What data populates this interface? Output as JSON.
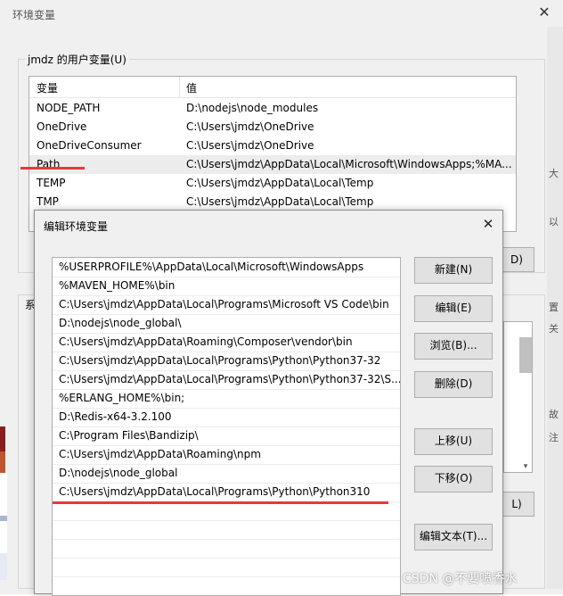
{
  "background_window": {
    "title": "环境变量",
    "close_glyph": "✕",
    "user_group_label": "jmdz 的用户变量(U)",
    "columns": {
      "name": "变量",
      "value": "值"
    },
    "user_vars": [
      {
        "name": "NODE_PATH",
        "value": "D:\\nodejs\\node_modules"
      },
      {
        "name": "OneDrive",
        "value": "C:\\Users\\jmdz\\OneDrive"
      },
      {
        "name": "OneDriveConsumer",
        "value": "C:\\Users\\jmdz\\OneDrive"
      },
      {
        "name": "Path",
        "value": "C:\\Users\\jmdz\\AppData\\Local\\Microsoft\\WindowsApps;%MA..."
      },
      {
        "name": "TEMP",
        "value": "C:\\Users\\jmdz\\AppData\\Local\\Temp"
      },
      {
        "name": "TMP",
        "value": "C:\\Users\\jmdz\\AppData\\Local\\Temp"
      }
    ],
    "selected_user_var": "Path",
    "sys_label_fragment": "系",
    "btn_fragment_d": "D)",
    "btn_fragment_l": "L)",
    "scroll_arrow": "▾"
  },
  "side_strip": [
    "大",
    "以",
    "置",
    "关",
    "故",
    "注"
  ],
  "edit_dialog": {
    "title": "编辑环境变量",
    "close_glyph": "✕",
    "paths": [
      "%USERPROFILE%\\AppData\\Local\\Microsoft\\WindowsApps",
      "%MAVEN_HOME%\\bin",
      "C:\\Users\\jmdz\\AppData\\Local\\Programs\\Microsoft VS Code\\bin",
      "D:\\nodejs\\node_global\\",
      "C:\\Users\\jmdz\\AppData\\Roaming\\Composer\\vendor\\bin",
      "C:\\Users\\jmdz\\AppData\\Local\\Programs\\Python\\Python37-32",
      "C:\\Users\\jmdz\\AppData\\Local\\Programs\\Python\\Python37-32\\S...",
      "%ERLANG_HOME%\\bin;",
      "D:\\Redis-x64-3.2.100",
      "C:\\Program Files\\Bandizip\\",
      "C:\\Users\\jmdz\\AppData\\Roaming\\npm",
      "D:\\nodejs\\node_global",
      "C:\\Users\\jmdz\\AppData\\Local\\Programs\\Python\\Python310"
    ],
    "buttons": {
      "new": "新建(N)",
      "edit": "编辑(E)",
      "browse": "浏览(B)...",
      "delete": "删除(D)",
      "move_up": "上移(U)",
      "move_down": "下移(O)",
      "edit_text": "编辑文本(T)..."
    }
  },
  "annotation_color": "#e63a3a",
  "watermark": "CSDN @不要喷香水"
}
